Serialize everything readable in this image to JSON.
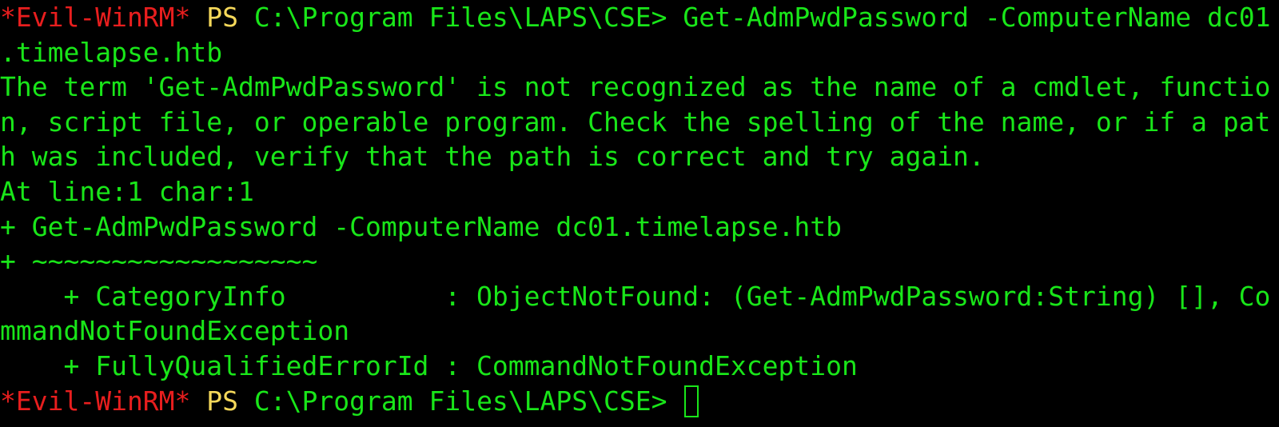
{
  "colors": {
    "background": "#000000",
    "prompt_tag": "#e81e1e",
    "prompt_ps": "#f5d85a",
    "text": "#19e619"
  },
  "prompt": {
    "tag": "*Evil-WinRM*",
    "ps": "PS",
    "path": "C:\\Program Files\\LAPS\\CSE>"
  },
  "command": {
    "text": " Get-AdmPwdPassword -ComputerName dc01",
    "wrap": ".timelapse.htb"
  },
  "error": {
    "message_lines": [
      "The term 'Get-AdmPwdPassword' is not recognized as the name of a cmdlet, functio",
      "n, script file, or operable program. Check the spelling of the name, or if a pat",
      "h was included, verify that the path is correct and try again."
    ],
    "location": "At line:1 char:1",
    "echo_line": "+ Get-AdmPwdPassword -ComputerName dc01.timelapse.htb",
    "underline": "+ ~~~~~~~~~~~~~~~~~~",
    "category_info": "    + CategoryInfo          : ObjectNotFound: (Get-AdmPwdPassword:String) [], Co",
    "category_wrap": "mmandNotFoundException",
    "fully_qualified": "    + FullyQualifiedErrorId : CommandNotFoundException"
  },
  "cursor_icon": "block-cursor-icon"
}
